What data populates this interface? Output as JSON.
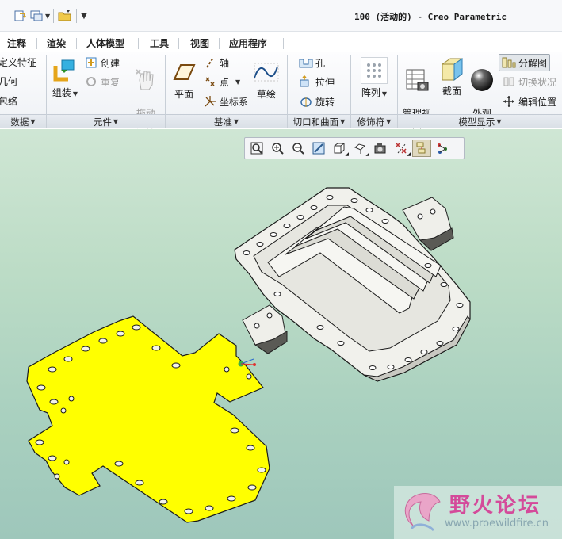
{
  "window": {
    "title": "100 (活动的) - Creo Parametric"
  },
  "quick_access": {
    "icons": [
      "regenerate-icon",
      "windows-icon",
      "folder-icon",
      "customize-icon"
    ]
  },
  "tabs": [
    "注释",
    "渲染",
    "人体模型",
    "工具",
    "视图",
    "应用程序"
  ],
  "ribbon": {
    "get_data": {
      "items": [
        "定义特征",
        "几何",
        "包络"
      ],
      "group_label": "数据"
    },
    "component": {
      "assemble": "组装",
      "create": "创建",
      "repeat": "重复",
      "drag": "拖动\n元件",
      "group_label": "元件"
    },
    "datum": {
      "plane": "平面",
      "axis": "轴",
      "point": "点",
      "csys": "坐标系",
      "sketch": "草绘",
      "group_label": "基准"
    },
    "cut_surface": {
      "hole": "孔",
      "extrude": "拉伸",
      "revolve": "旋转",
      "group_label": "切口和曲面"
    },
    "modifiers": {
      "pattern": "阵列",
      "group_label": "修饰符"
    },
    "model_display": {
      "manage_views": "管理视\n图",
      "section": "截面",
      "appearance": "外观\n库",
      "explode": "分解图",
      "toggle_status": "切换状况",
      "edit_position": "编辑位置",
      "group_label": "模型显示"
    }
  },
  "view_toolbar": {
    "buttons": [
      "refit-icon",
      "zoom-in-icon",
      "zoom-out-icon",
      "repaint-icon",
      "display-style-icon",
      "saved-orientations-icon",
      "named-views-icon",
      "datum-display-icon",
      "explode-view-icon",
      "spin-center-icon"
    ]
  },
  "watermark": {
    "name": "野火论坛",
    "url": "www.proewildfire.cn"
  },
  "colors": {
    "yellow_part": "#ffff00",
    "background_top": "#cfe6d4",
    "background_bottom": "#9ec7bb",
    "watermark_pink": "#d44a9a"
  }
}
